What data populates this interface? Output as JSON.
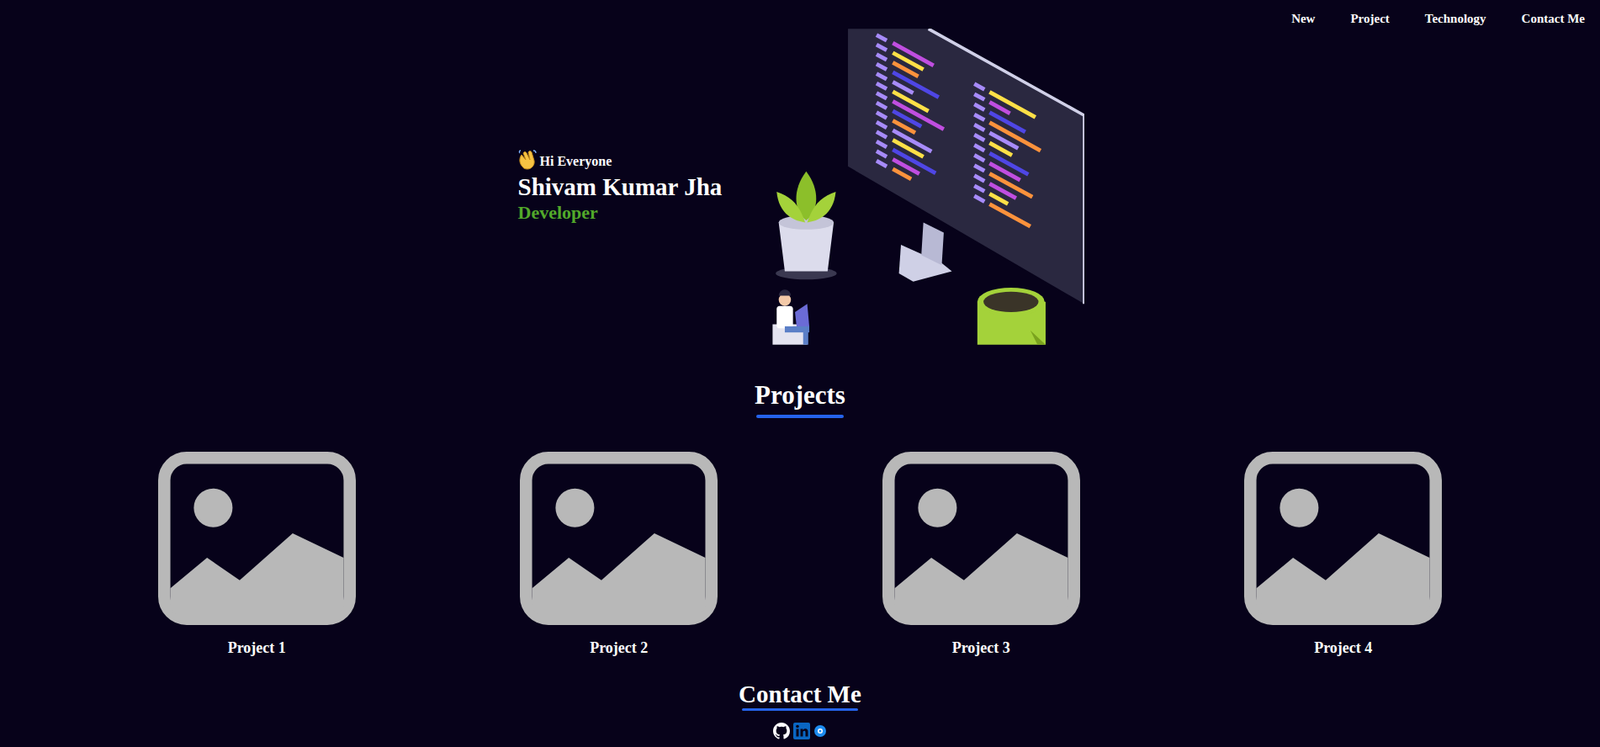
{
  "nav": {
    "items": [
      {
        "label": "New"
      },
      {
        "label": "Project"
      },
      {
        "label": "Technology"
      },
      {
        "label": "Contact Me"
      }
    ]
  },
  "hero": {
    "greeting": "Hi Everyone",
    "name": "Shivam Kumar Jha",
    "role": "Developer"
  },
  "projects": {
    "title": "Projects",
    "items": [
      {
        "title": "Project 1"
      },
      {
        "title": "Project 2"
      },
      {
        "title": "Project 3"
      },
      {
        "title": "Project 4"
      }
    ]
  },
  "contact": {
    "title": "Contact Me"
  }
}
